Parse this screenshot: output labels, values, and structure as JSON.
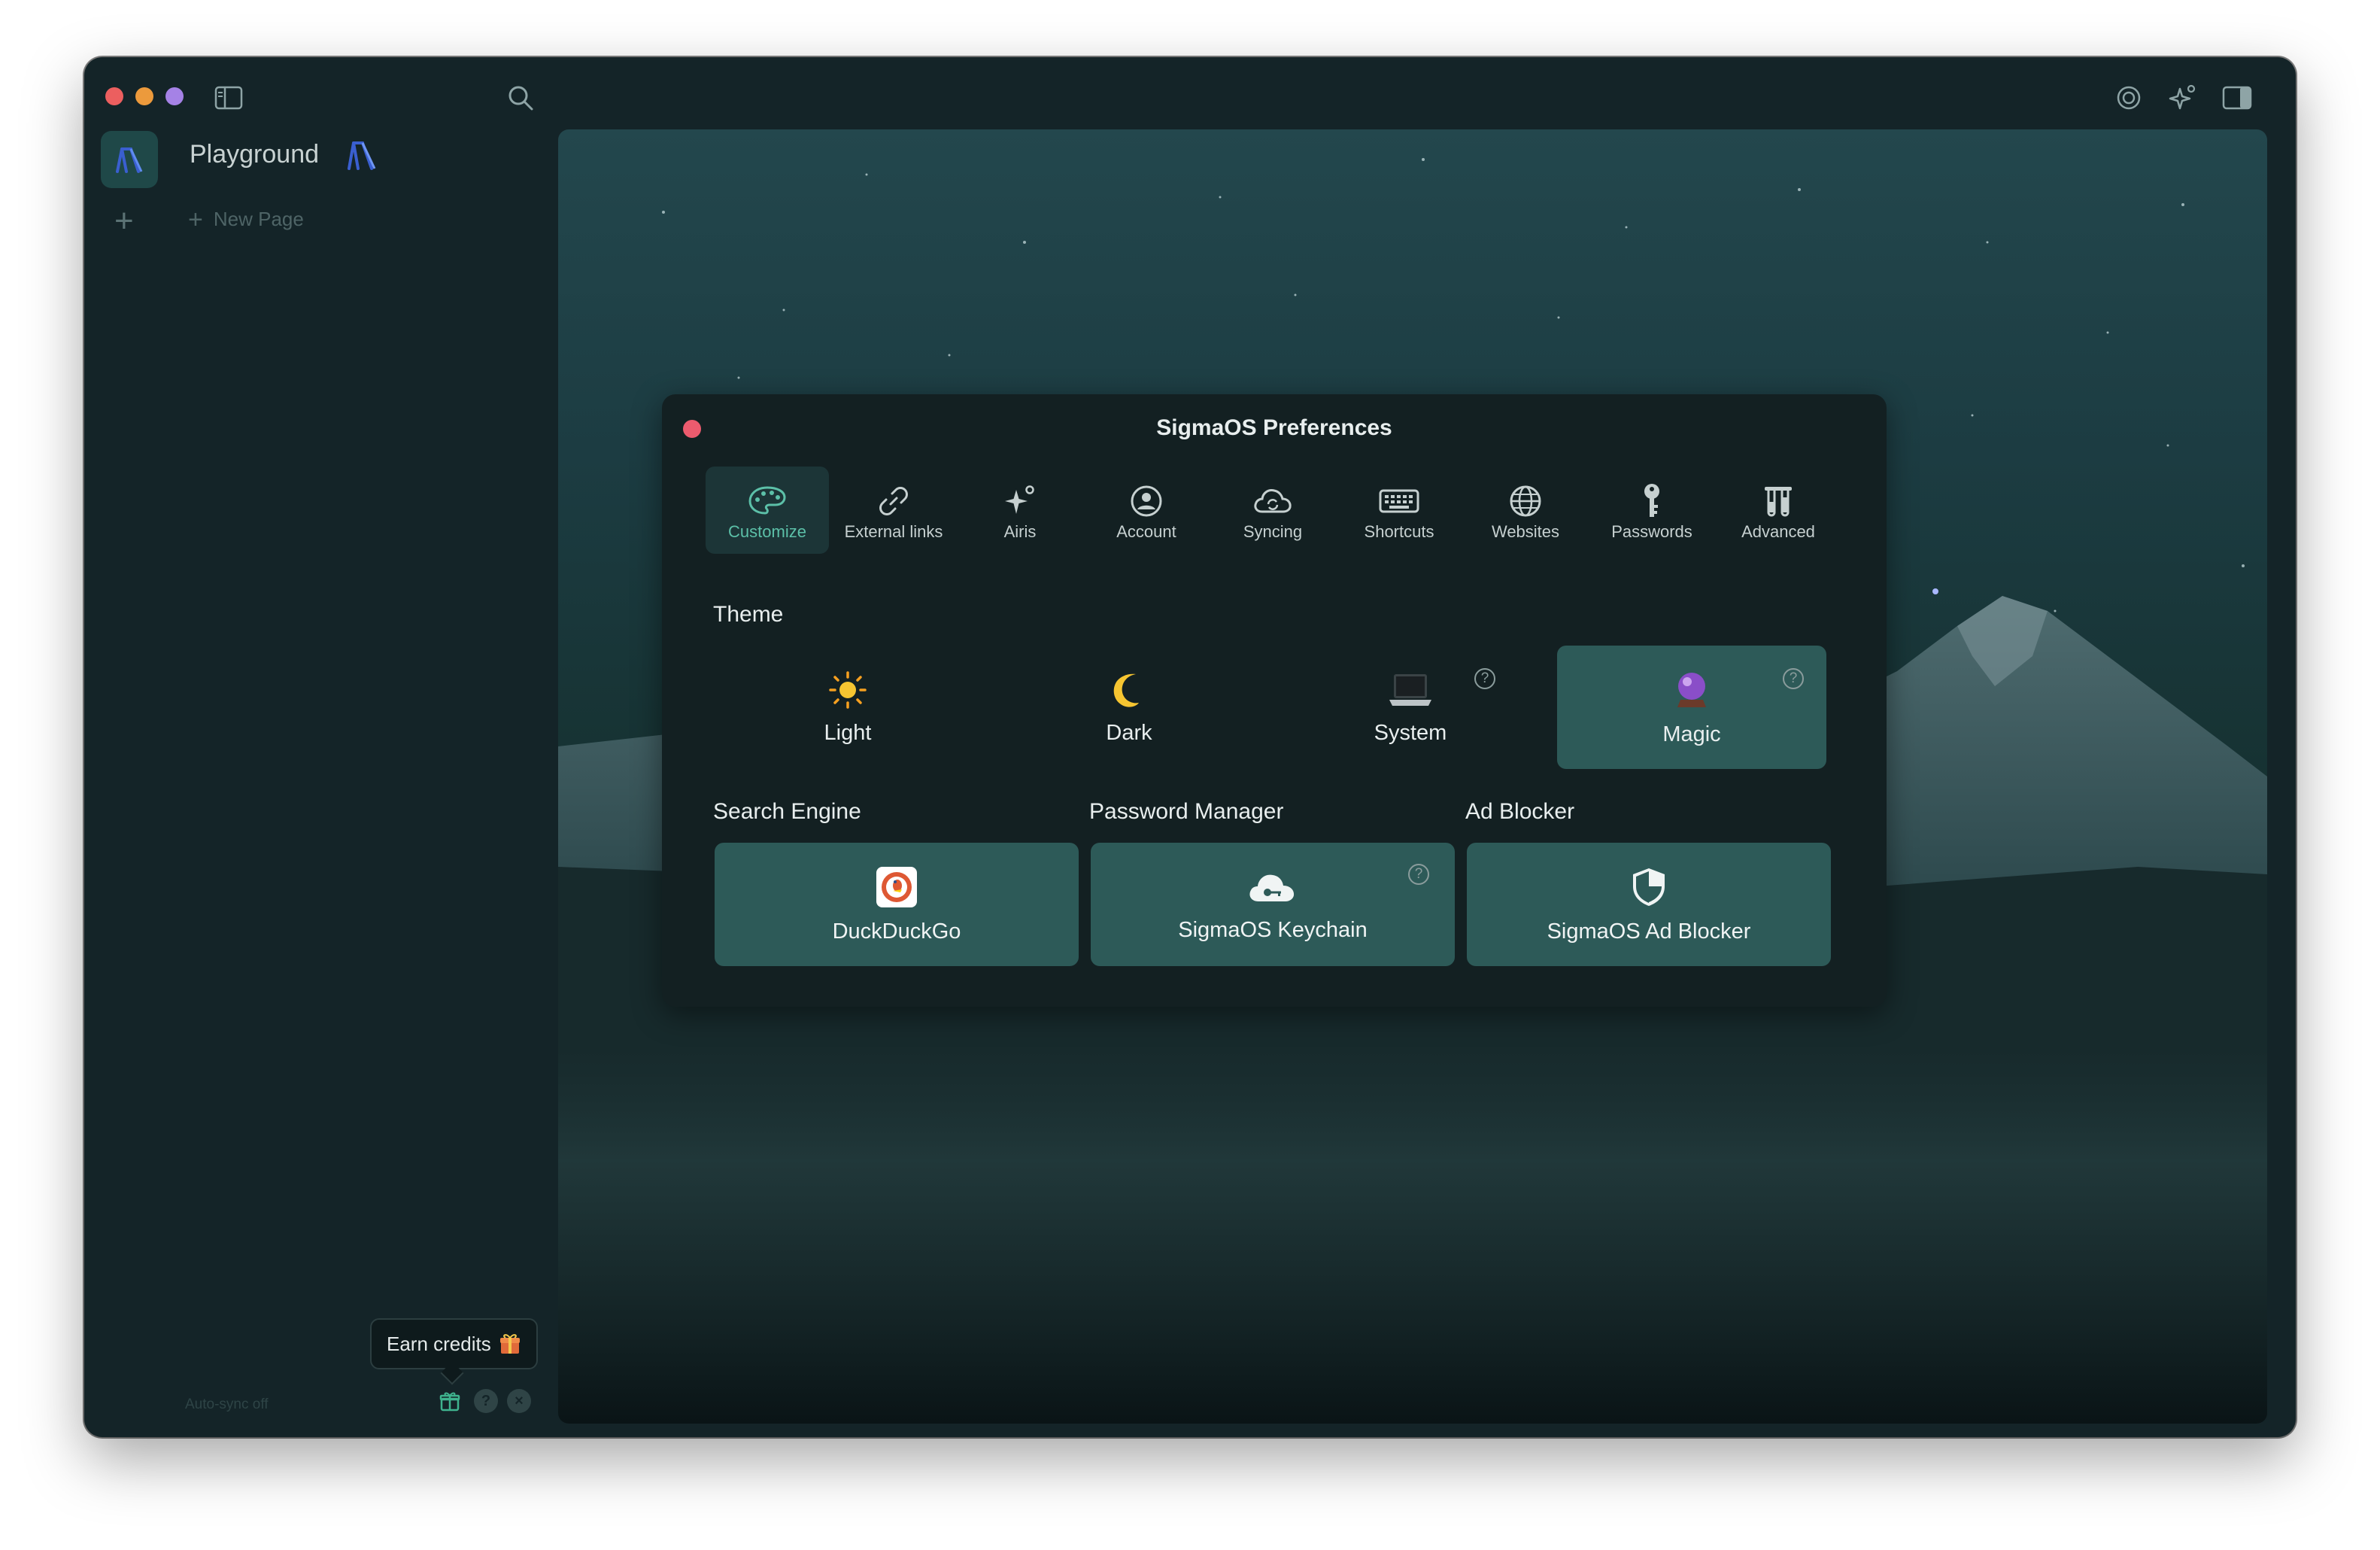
{
  "window": {
    "space_title": "Playground",
    "new_page_label": "New Page",
    "auto_sync": "Auto-sync off",
    "earn_credits": "Earn credits"
  },
  "dialog": {
    "title": "SigmaOS Preferences",
    "tabs": [
      {
        "label": "Customize",
        "icon": "palette-icon",
        "active": true
      },
      {
        "label": "External links",
        "icon": "link-icon"
      },
      {
        "label": "Airis",
        "icon": "sparkle-icon"
      },
      {
        "label": "Account",
        "icon": "user-circle-icon"
      },
      {
        "label": "Syncing",
        "icon": "cloud-sync-icon"
      },
      {
        "label": "Shortcuts",
        "icon": "keyboard-icon"
      },
      {
        "label": "Websites",
        "icon": "globe-icon"
      },
      {
        "label": "Passwords",
        "icon": "key-icon"
      },
      {
        "label": "Advanced",
        "icon": "test-tubes-icon"
      }
    ],
    "theme_label": "Theme",
    "themes": [
      {
        "label": "Light",
        "icon": "sun-icon"
      },
      {
        "label": "Dark",
        "icon": "moon-icon"
      },
      {
        "label": "System",
        "icon": "laptop-icon"
      },
      {
        "label": "Magic",
        "icon": "crystal-ball-icon",
        "selected": true
      }
    ],
    "search_engine_label": "Search Engine",
    "password_manager_label": "Password Manager",
    "ad_blocker_label": "Ad Blocker",
    "search_engine": "DuckDuckGo",
    "password_manager": "SigmaOS Keychain",
    "ad_blocker": "SigmaOS Ad Blocker"
  },
  "colors": {
    "accent": "#5cc0a8",
    "selected_card": "#2d5a58",
    "dialog_bg": "#132022",
    "sidebar_bg": "#142428"
  }
}
